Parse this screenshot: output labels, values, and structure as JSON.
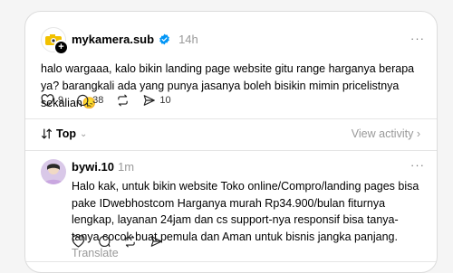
{
  "post": {
    "username": "mykamera.sub",
    "time": "14h",
    "text": "halo wargaaa, kalo bikin landing page website gitu range harganya berapa ya? barangkali ada yang punya jasanya boleh bisikin mimin pricelistnya sekalian",
    "emoji": "😞",
    "likes": "9",
    "comments": "38",
    "shares": "10",
    "more": "···"
  },
  "sort": {
    "label": "Top",
    "view_activity": "View activity"
  },
  "reply": {
    "username": "bywi.10",
    "time": "1m",
    "text": "Halo kak, untuk bikin website Toko online/Compro/landing pages bisa pake IDwebhostcom Harganya murah Rp34.900/bulan fiturnya lengkap, layanan 24jam dan cs support-nya responsif bisa tanya-tanya cocok buat pemula dan Aman untuk bisnis jangka panjang.",
    "translate": "Translate",
    "more": "···"
  },
  "colors": {
    "verified": "#0095f6",
    "muted": "#999999",
    "avatar_bg": "#d9c8e8"
  }
}
